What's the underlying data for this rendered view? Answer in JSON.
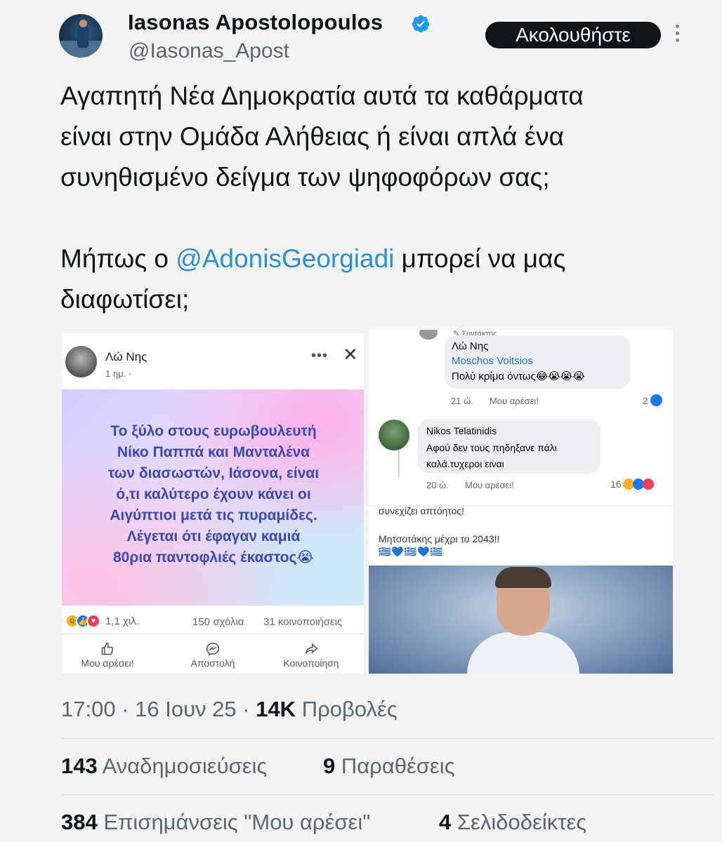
{
  "tweet": {
    "author_name": "Iasonas Apostolopoulos",
    "handle": "@Iasonas_Apost",
    "follow_label": "Ακολουθήστε",
    "text_lines": [
      "Αγαπητή Νέα Δημοκρατία αυτά τα καθάρματα",
      "είναι στην Ομάδα Αλήθειας ή είναι απλά ένα",
      "συνηθισμένο δείγμα των ψηφοφόρων σας;"
    ],
    "text_line4_before": "Μήπως ο ",
    "mention": "@AdonisGeorgiadi",
    "text_line4_after": " μπορεί να μας",
    "text_line5": "διαφωτίσει;",
    "time": "17:00",
    "date": "16 Ιουν 25",
    "views_count": "14K",
    "views_label": "Προβολές",
    "reposts_count": "143",
    "reposts_label": "Αναδημοσιεύσεις",
    "quotes_count": "9",
    "quotes_label": "Παραθέσεις",
    "likes_count": "384",
    "likes_label": "Επισημάνσεις \"Μου αρέσει\"",
    "bookmarks_count": "4",
    "bookmarks_label": "Σελιδοδείκτες",
    "accent_color": "#2b8fd6"
  },
  "fb_post": {
    "author": "Λώ Νης",
    "time": "1 ημ. ·",
    "text_lines": [
      "Το ξύλο στους ευρωβουλευτή",
      "Νίκο Παππά και Μανταλένα",
      "των διασωστών, Ιάσονα, είναι",
      "ό,τι καλύτερο έχουν κάνει οι",
      "Αιγύπτιοι μετά τις πυραμίδες.",
      "Λέγεται ότι έφαγαν καμιά",
      "80ρια παντοφλιές έκαστος😭"
    ],
    "reactions_count": "1,1 χιλ.",
    "comments": "150 σχόλια",
    "shares": "31 κοινοποιήσεις",
    "action_like": "Μου αρέσει!",
    "action_send": "Αποστολή",
    "action_share": "Κοινοποίηση"
  },
  "fb_comments": {
    "editor_tag": "Συντάκτης",
    "c1_name": "Λώ Νης",
    "c1_mention": "Moschos Voitsios",
    "c1_text": "Πολύ κρίμα όντως😂😭😭😭",
    "c1_time": "21 ώ.",
    "c1_like": "Μου αρέσει!",
    "c1_count": "2",
    "c2_name": "Nikos Telatinidis",
    "c2_text_1": "Αφού δεν τους πηδηξανε πάλι",
    "c2_text_2": "καλά.τυχεροι ειναι",
    "c2_time": "20 ώ.",
    "c2_like": "Μου αρέσει!",
    "c2_count": "16"
  },
  "fb_bottom": {
    "line1": "συνεχίζει απτόητος!",
    "line2": "Μητσοτάκης μέχρι το 2043!!",
    "flags": "🇬🇷💙🇬🇷💙🇬🇷"
  }
}
